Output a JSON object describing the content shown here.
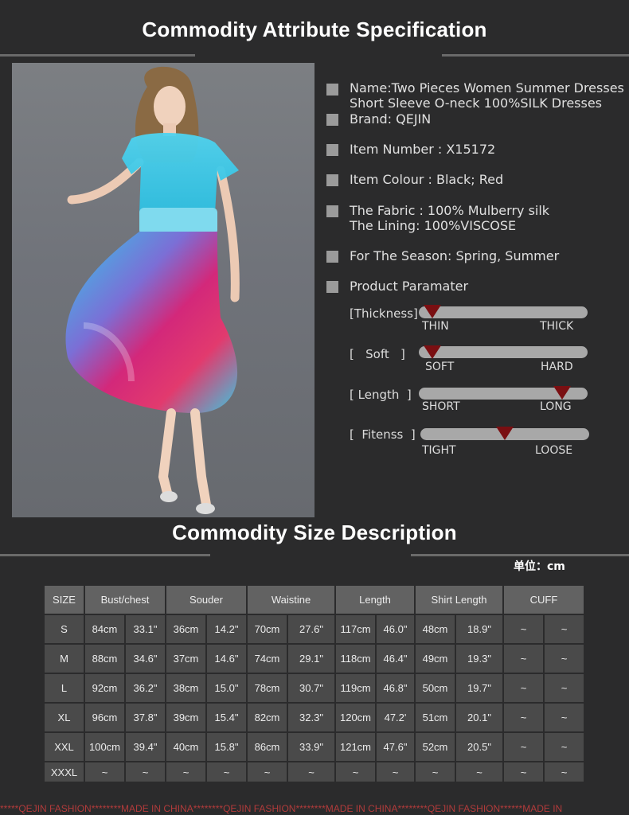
{
  "header": {
    "title": "Commodity Attribute Specification"
  },
  "attributes": [
    {
      "line1": "Name:Two Pieces Women Summer Dresses",
      "line2": " Short Sleeve O-neck 100%SILK Dresses"
    },
    {
      "line1": "Brand: QEJIN"
    },
    {
      "line1": "Item Number : X15172"
    },
    {
      "line1": "Item Colour : Black; Red"
    },
    {
      "line1": "The Fabric : 100% Mulberry silk",
      "line2": "The Lining: 100%VISCOSE"
    },
    {
      "line1": "For The Season:  Spring, Summer"
    },
    {
      "line1": "Product Paramater"
    }
  ],
  "params": [
    {
      "label": "[Thickness]",
      "left": "THIN",
      "right": "THICK",
      "level": 0.08
    },
    {
      "label": "[   Soft   ]",
      "left": "SOFT",
      "right": "HARD",
      "level": 0.08
    },
    {
      "label": "[ Length  ]",
      "left": "SHORT",
      "right": "LONG",
      "level": 0.85
    },
    {
      "label": "[  Fitenss  ]",
      "left": "TIGHT",
      "right": "LOOSE",
      "level": 0.5
    }
  ],
  "size_section": {
    "title": "Commodity Size Description",
    "unit": "单位：cm"
  },
  "size_table": {
    "headers": [
      "SIZE",
      "Bust/chest",
      "Souder",
      "Waistine",
      "Length",
      "Shirt Length",
      "CUFF"
    ],
    "rows": [
      [
        "S",
        "84cm",
        "33.1\"",
        "36cm",
        "14.2\"",
        "70cm",
        "27.6\"",
        "117cm",
        "46.0\"",
        "48cm",
        "18.9\"",
        "~",
        "~"
      ],
      [
        "M",
        "88cm",
        "34.6\"",
        "37cm",
        "14.6\"",
        "74cm",
        "29.1\"",
        "118cm",
        "46.4\"",
        "49cm",
        "19.3\"",
        "~",
        "~"
      ],
      [
        "L",
        "92cm",
        "36.2\"",
        "38cm",
        "15.0\"",
        "78cm",
        "30.7\"",
        "119cm",
        "46.8\"",
        "50cm",
        "19.7\"",
        "~",
        "~"
      ],
      [
        "XL",
        "96cm",
        "37.8\"",
        "39cm",
        "15.4\"",
        "82cm",
        "32.3\"",
        "120cm",
        "47.2'",
        "51cm",
        "20.1\"",
        "~",
        "~"
      ],
      [
        "XXL",
        "100cm",
        "39.4\"",
        "40cm",
        "15.8\"",
        "86cm",
        "33.9\"",
        "121cm",
        "47.6\"",
        "52cm",
        "20.5\"",
        "~",
        "~"
      ],
      [
        "XXXL",
        "~",
        "~",
        "~",
        "~",
        "~",
        "~",
        "~",
        "~",
        "~",
        "~",
        "~",
        "~"
      ]
    ]
  },
  "footer": {
    "text": "*****QEJIN FASHION********MADE IN CHINA********QEJIN FASHION********MADE IN CHINA********QEJIN FASHION******MADE IN"
  },
  "colors": {
    "background": "#2b2b2c",
    "cell": "#4a4a4a",
    "header_cell": "#626262",
    "marker": "#7a0f12",
    "footer": "#b13b3b"
  }
}
